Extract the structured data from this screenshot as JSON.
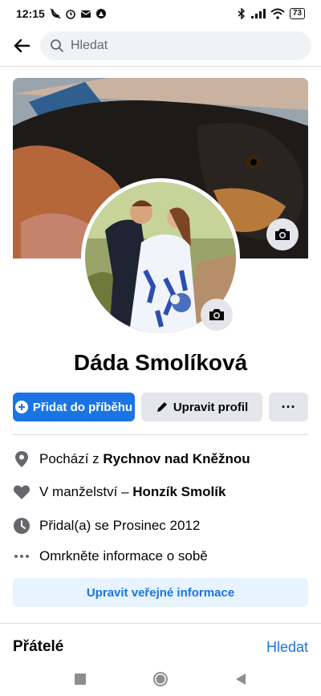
{
  "status_bar": {
    "time": "12:15",
    "battery": "73",
    "icons": [
      "phone-off-icon",
      "alarm-icon",
      "mail-icon",
      "app-icon",
      "bluetooth-icon",
      "signal-icon",
      "wifi-icon",
      "battery-icon"
    ]
  },
  "header": {
    "search_placeholder": "Hledat"
  },
  "profile": {
    "name": "Dáda Smolíková"
  },
  "actions": {
    "add_story": "Přidat do příběhu",
    "edit_profile": "Upravit profil",
    "more": "···"
  },
  "details": {
    "from_prefix": "Pochází z ",
    "from_place": "Rychnov nad Kněžnou",
    "relationship_prefix": "V manželství – ",
    "relationship_partner": "Honzík Smolík",
    "joined": "Přidal(a) se Prosinec 2012",
    "about": "Omrkněte informace o sobě"
  },
  "edit_public": "Upravit veřejné informace",
  "friends": {
    "title": "Přátelé",
    "search": "Hledat"
  },
  "colors": {
    "accent": "#1b74e4",
    "button_gray": "#e4e6eb",
    "light_blue": "#e7f3ff"
  }
}
